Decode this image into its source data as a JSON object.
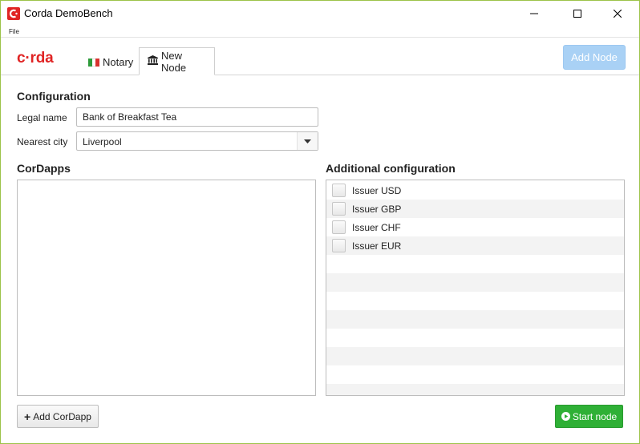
{
  "window": {
    "title": "Corda DemoBench",
    "accent": "#9cc34a"
  },
  "menubar": {
    "file": "File"
  },
  "header": {
    "logo": "c·rda",
    "tabs": [
      {
        "label": "Notary",
        "icon": "italy-flag-icon"
      },
      {
        "label": "New Node",
        "icon": "bank-icon"
      }
    ],
    "add_node_label": "Add Node"
  },
  "configuration": {
    "title": "Configuration",
    "legal_name_label": "Legal name",
    "legal_name_value": "Bank of Breakfast Tea",
    "nearest_city_label": "Nearest city",
    "nearest_city_value": "Liverpool"
  },
  "cordapps": {
    "title": "CorDapps"
  },
  "additional": {
    "title": "Additional configuration",
    "items": [
      {
        "label": "Issuer USD"
      },
      {
        "label": "Issuer GBP"
      },
      {
        "label": "Issuer CHF"
      },
      {
        "label": "Issuer EUR"
      }
    ]
  },
  "actions": {
    "add_cordapp_label": "Add CorDapp",
    "start_node_label": "Start node"
  },
  "colors": {
    "brand_red": "#e02424",
    "start_green": "#2fb036",
    "add_node_disabled": "#a9d1f5"
  }
}
